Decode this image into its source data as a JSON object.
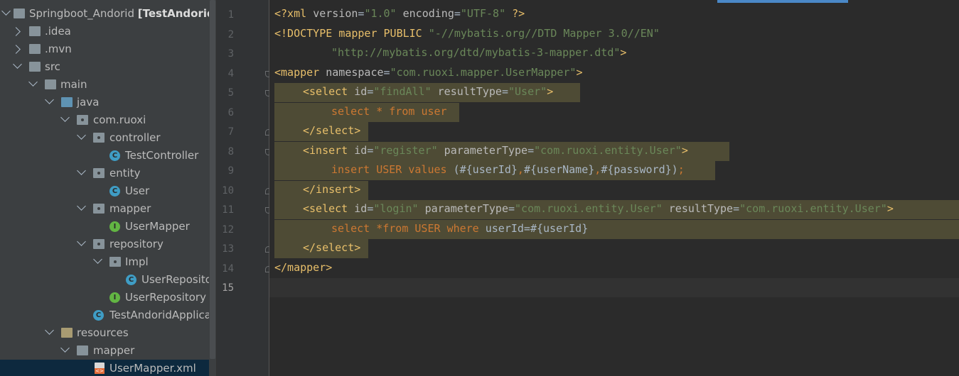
{
  "project_tree": {
    "root": {
      "name": "Springboot_Andorid",
      "module": "[TestAndorid]"
    },
    "items": [
      {
        "label": "Springboot_Andorid"
      },
      {
        "label": ".idea"
      },
      {
        "label": ".mvn"
      },
      {
        "label": "src"
      },
      {
        "label": "main"
      },
      {
        "label": "java"
      },
      {
        "label": "com.ruoxi"
      },
      {
        "label": "controller"
      },
      {
        "label": "TestController"
      },
      {
        "label": "entity"
      },
      {
        "label": "User"
      },
      {
        "label": "mapper"
      },
      {
        "label": "UserMapper"
      },
      {
        "label": "repository"
      },
      {
        "label": "Impl"
      },
      {
        "label": "UserRepositor"
      },
      {
        "label": "UserRepository"
      },
      {
        "label": "TestAndoridApplicat"
      },
      {
        "label": "resources"
      },
      {
        "label": "mapper"
      },
      {
        "label": "UserMapper.xml"
      }
    ],
    "selected": "UserMapper.xml"
  },
  "editor": {
    "file": "UserMapper.xml",
    "current_line": 15,
    "line_numbers": [
      "1",
      "2",
      "3",
      "4",
      "5",
      "6",
      "7",
      "8",
      "9",
      "10",
      "11",
      "12",
      "13",
      "14",
      "15"
    ],
    "lines": {
      "l1": {
        "a": "<?xml ",
        "b": "version",
        "c": "=",
        "d": "\"1.0\"",
        "e": " encoding",
        "f": "=",
        "g": "\"UTF-8\"",
        "h": " ?>"
      },
      "l2": {
        "a": "<!DOCTYPE ",
        "b": "mapper PUBLIC ",
        "c": "\"-//mybatis.org//DTD Mapper 3.0//EN\""
      },
      "l3": {
        "a": "\"http://mybatis.org/dtd/mybatis-3-mapper.dtd\"",
        "b": ">"
      },
      "l4": {
        "a": "<mapper ",
        "b": "namespace",
        "c": "=",
        "d": "\"com.ruoxi.mapper.UserMapper\"",
        "e": ">"
      },
      "l5": {
        "a": "<select ",
        "b": "id",
        "c": "=",
        "d": "\"findAll\"",
        "e": " resultType",
        "f": "=",
        "g": "\"User\"",
        "h": ">"
      },
      "l6": {
        "a": "select ",
        "b": "* ",
        "c": "from ",
        "d": "user"
      },
      "l7": {
        "a": "</select>"
      },
      "l8": {
        "a": "<insert ",
        "b": "id",
        "c": "=",
        "d": "\"register\"",
        "e": " parameterType",
        "f": "=",
        "g": "\"com.ruoxi.entity.User\"",
        "h": ">"
      },
      "l9": {
        "a": "insert ",
        "b": "USER ",
        "c": "values ",
        "d": "(#{userId}",
        "e": ",",
        "f": "#{userName}",
        "g": ",",
        "h": "#{password})",
        "i": ";"
      },
      "l10": {
        "a": "</insert>"
      },
      "l11": {
        "a": "<select ",
        "b": "id",
        "c": "=",
        "d": "\"login\"",
        "e": " parameterType",
        "f": "=",
        "g": "\"com.ruoxi.entity.User\"",
        "h": " resultType",
        "i": "=",
        "j": "\"com.ruoxi.entity.User\"",
        "k": ">"
      },
      "l12": {
        "a": "select ",
        "b": "*",
        "c": "from ",
        "d": "USER ",
        "e": "where ",
        "f": "userId=#{userId}"
      },
      "l13": {
        "a": "</select>"
      },
      "l14": {
        "a": "</mapper>"
      }
    }
  }
}
